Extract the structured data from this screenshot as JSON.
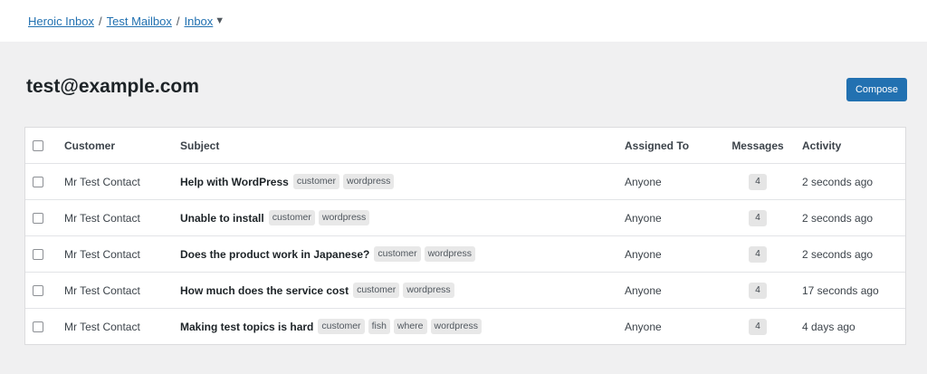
{
  "breadcrumb": {
    "items": [
      "Heroic Inbox",
      "Test Mailbox",
      "Inbox"
    ],
    "separator": "/",
    "dropdown_glyph": "▼"
  },
  "page_title": "test@example.com",
  "compose_label": "Compose",
  "table": {
    "headers": {
      "customer": "Customer",
      "subject": "Subject",
      "assigned": "Assigned To",
      "messages": "Messages",
      "activity": "Activity"
    },
    "rows": [
      {
        "customer": "Mr Test Contact",
        "subject": "Help with WordPress",
        "tags": [
          "customer",
          "wordpress"
        ],
        "assigned": "Anyone",
        "messages": "4",
        "activity": "2 seconds ago"
      },
      {
        "customer": "Mr Test Contact",
        "subject": "Unable to install",
        "tags": [
          "customer",
          "wordpress"
        ],
        "assigned": "Anyone",
        "messages": "4",
        "activity": "2 seconds ago"
      },
      {
        "customer": "Mr Test Contact",
        "subject": "Does the product work in Japanese?",
        "tags": [
          "customer",
          "wordpress"
        ],
        "assigned": "Anyone",
        "messages": "4",
        "activity": "2 seconds ago"
      },
      {
        "customer": "Mr Test Contact",
        "subject": "How much does the service cost",
        "tags": [
          "customer",
          "wordpress"
        ],
        "assigned": "Anyone",
        "messages": "4",
        "activity": "17 seconds ago"
      },
      {
        "customer": "Mr Test Contact",
        "subject": "Making test topics is hard",
        "tags": [
          "customer",
          "fish",
          "where",
          "wordpress"
        ],
        "assigned": "Anyone",
        "messages": "4",
        "activity": "4 days ago"
      }
    ]
  },
  "colors": {
    "accent": "#2271b1",
    "background": "#f0f0f1",
    "tag_bg": "#e8e8e8"
  }
}
